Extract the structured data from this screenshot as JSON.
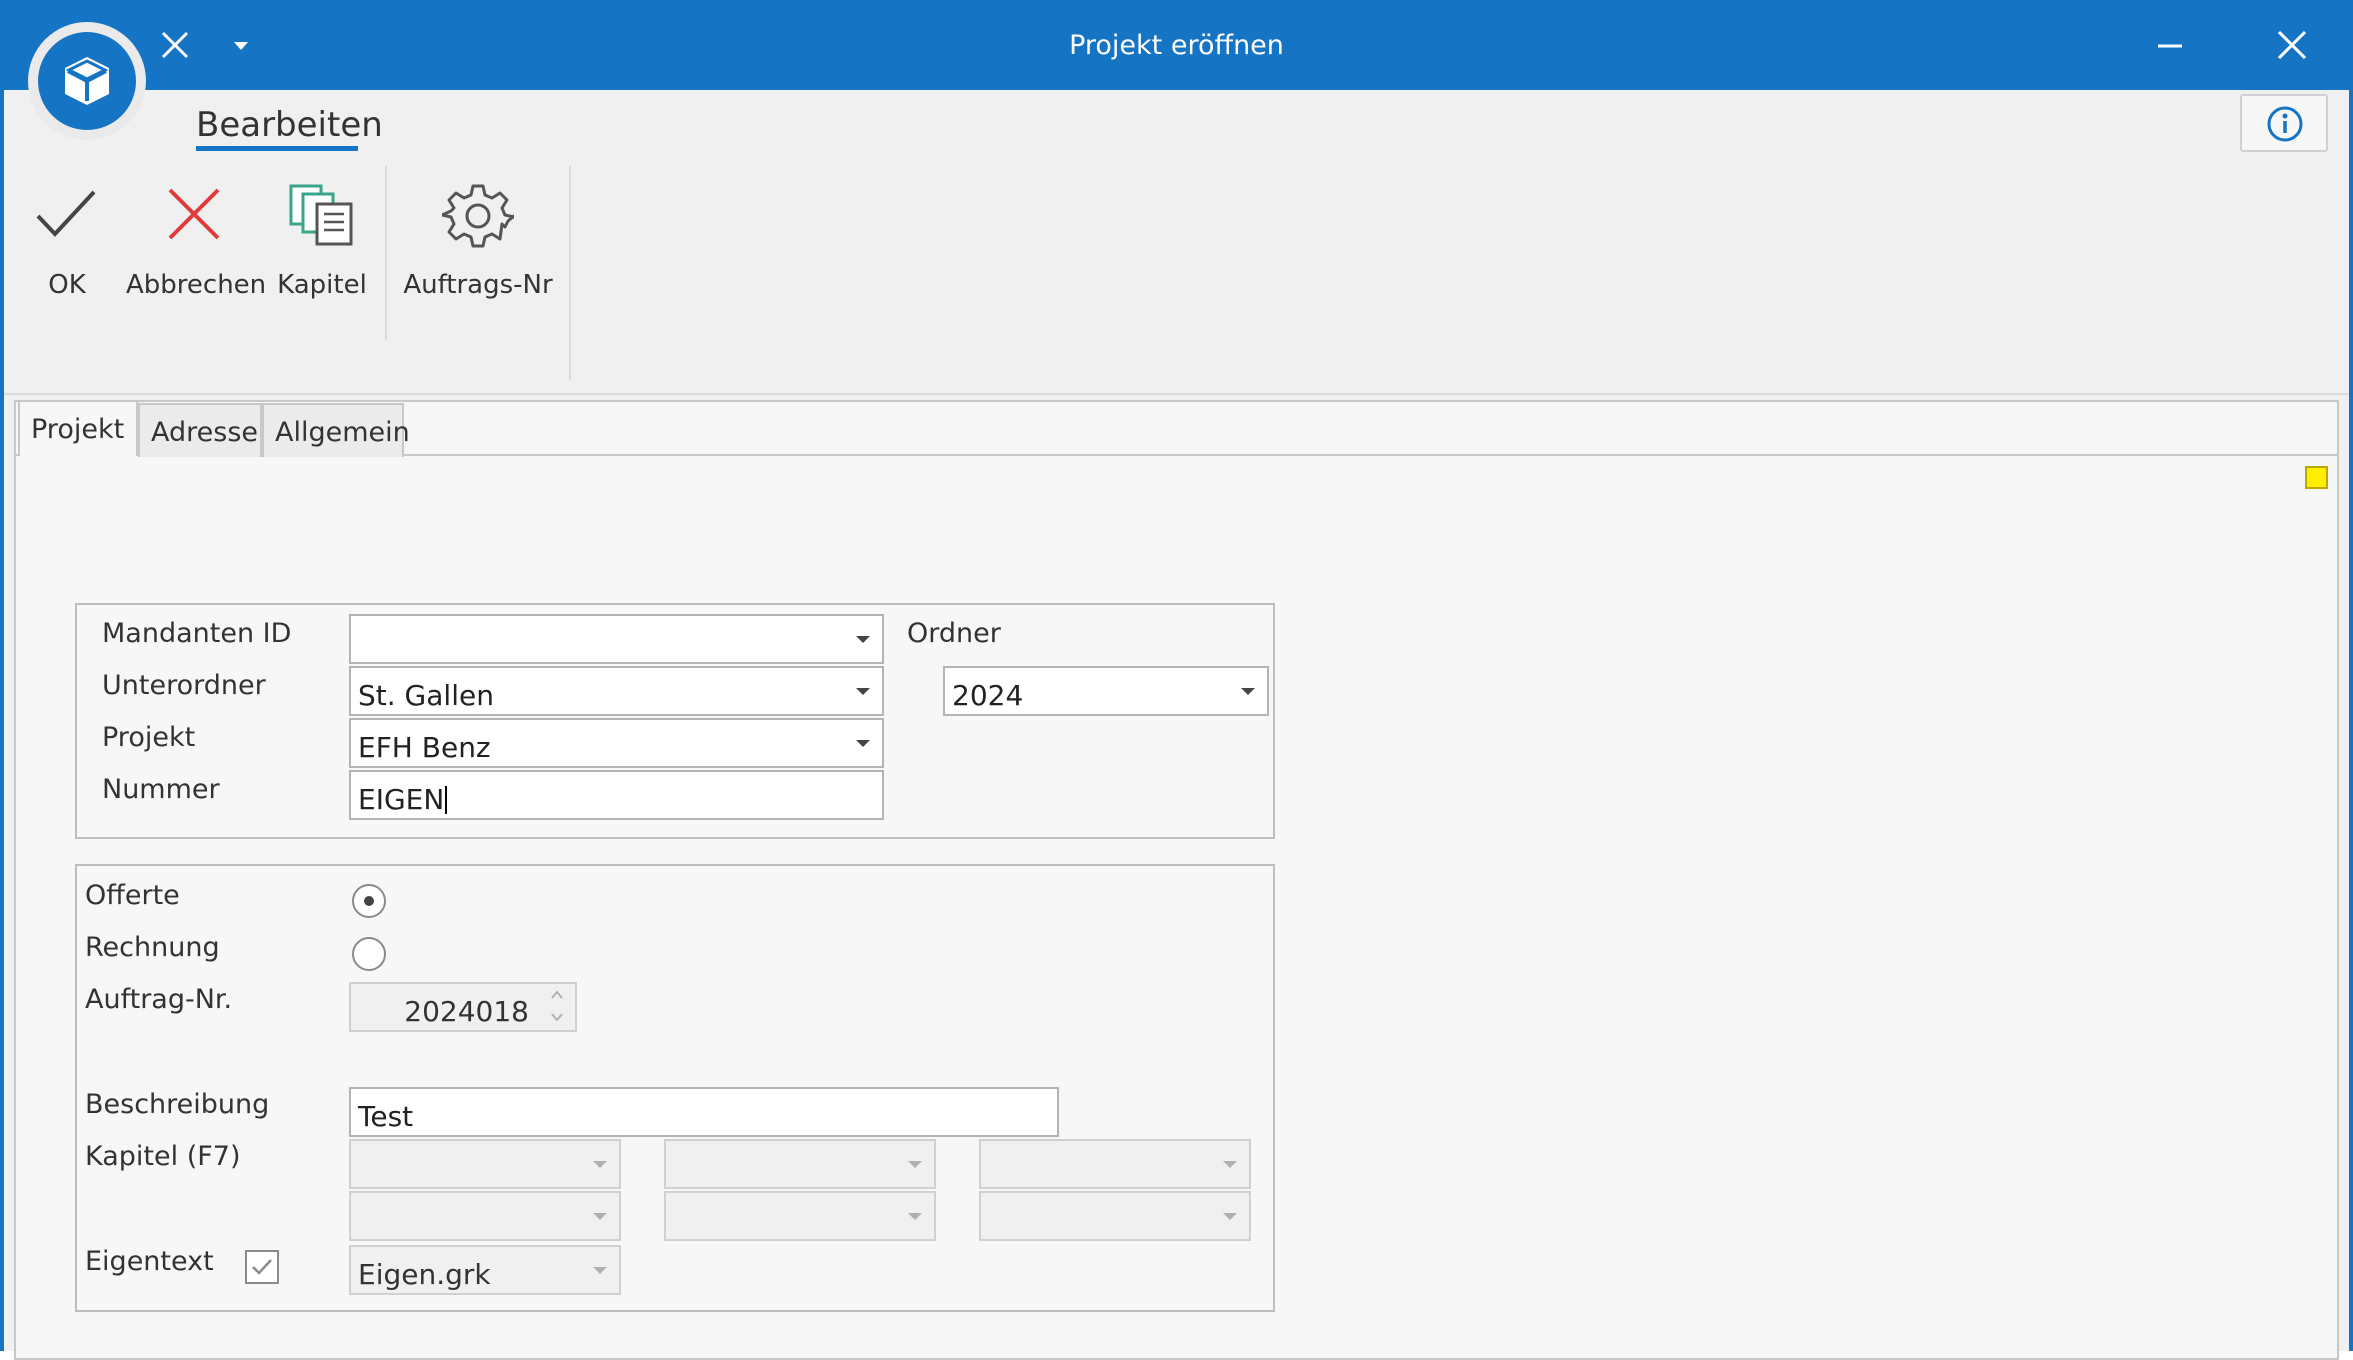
{
  "window": {
    "title": "Projekt eröffnen",
    "ribbon_tab": "Bearbeiten"
  },
  "toolbar": {
    "ok_label": "OK",
    "cancel_label": "Abbrechen",
    "chapter_label": "Kapitel",
    "order_number_label": "Auftrags-Nr"
  },
  "tabs": [
    "Projekt",
    "Adresse",
    "Allgemein"
  ],
  "form": {
    "mandanten_id_label": "Mandanten ID",
    "mandanten_id_value": "",
    "unterordner_label": "Unterordner",
    "unterordner_value": "St. Gallen",
    "projekt_label": "Projekt",
    "projekt_value": "EFH Benz",
    "nummer_label": "Nummer",
    "nummer_value": "EIGEN",
    "ordner_label": "Ordner",
    "ordner_value": "2024",
    "offerte_label": "Offerte",
    "rechnung_label": "Rechnung",
    "auftrag_nr_label": "Auftrag-Nr.",
    "auftrag_nr_value": "2024018",
    "beschreibung_label": "Beschreibung",
    "beschreibung_value": "Test",
    "kapitel_label": "Kapitel (F7)",
    "eigentext_label": "Eigentext",
    "eigentext_value": "Eigen.grk",
    "eigentext_checked": true,
    "selected_type": "Offerte"
  },
  "colors": {
    "titlebar": "#1574c4",
    "cancel_red": "#e23b3b",
    "chapter_teal": "#3aa58a",
    "indicator_yellow": "#ffee00"
  },
  "icons": {
    "app": "cube-icon",
    "quick_close": "close-icon",
    "quick_menu": "chevron-down-icon",
    "minimize": "minimize-icon",
    "close": "close-icon",
    "info": "info-icon",
    "ok": "checkmark-icon",
    "cancel": "cross-icon",
    "chapter": "documents-icon",
    "order_number": "gear-icon"
  }
}
